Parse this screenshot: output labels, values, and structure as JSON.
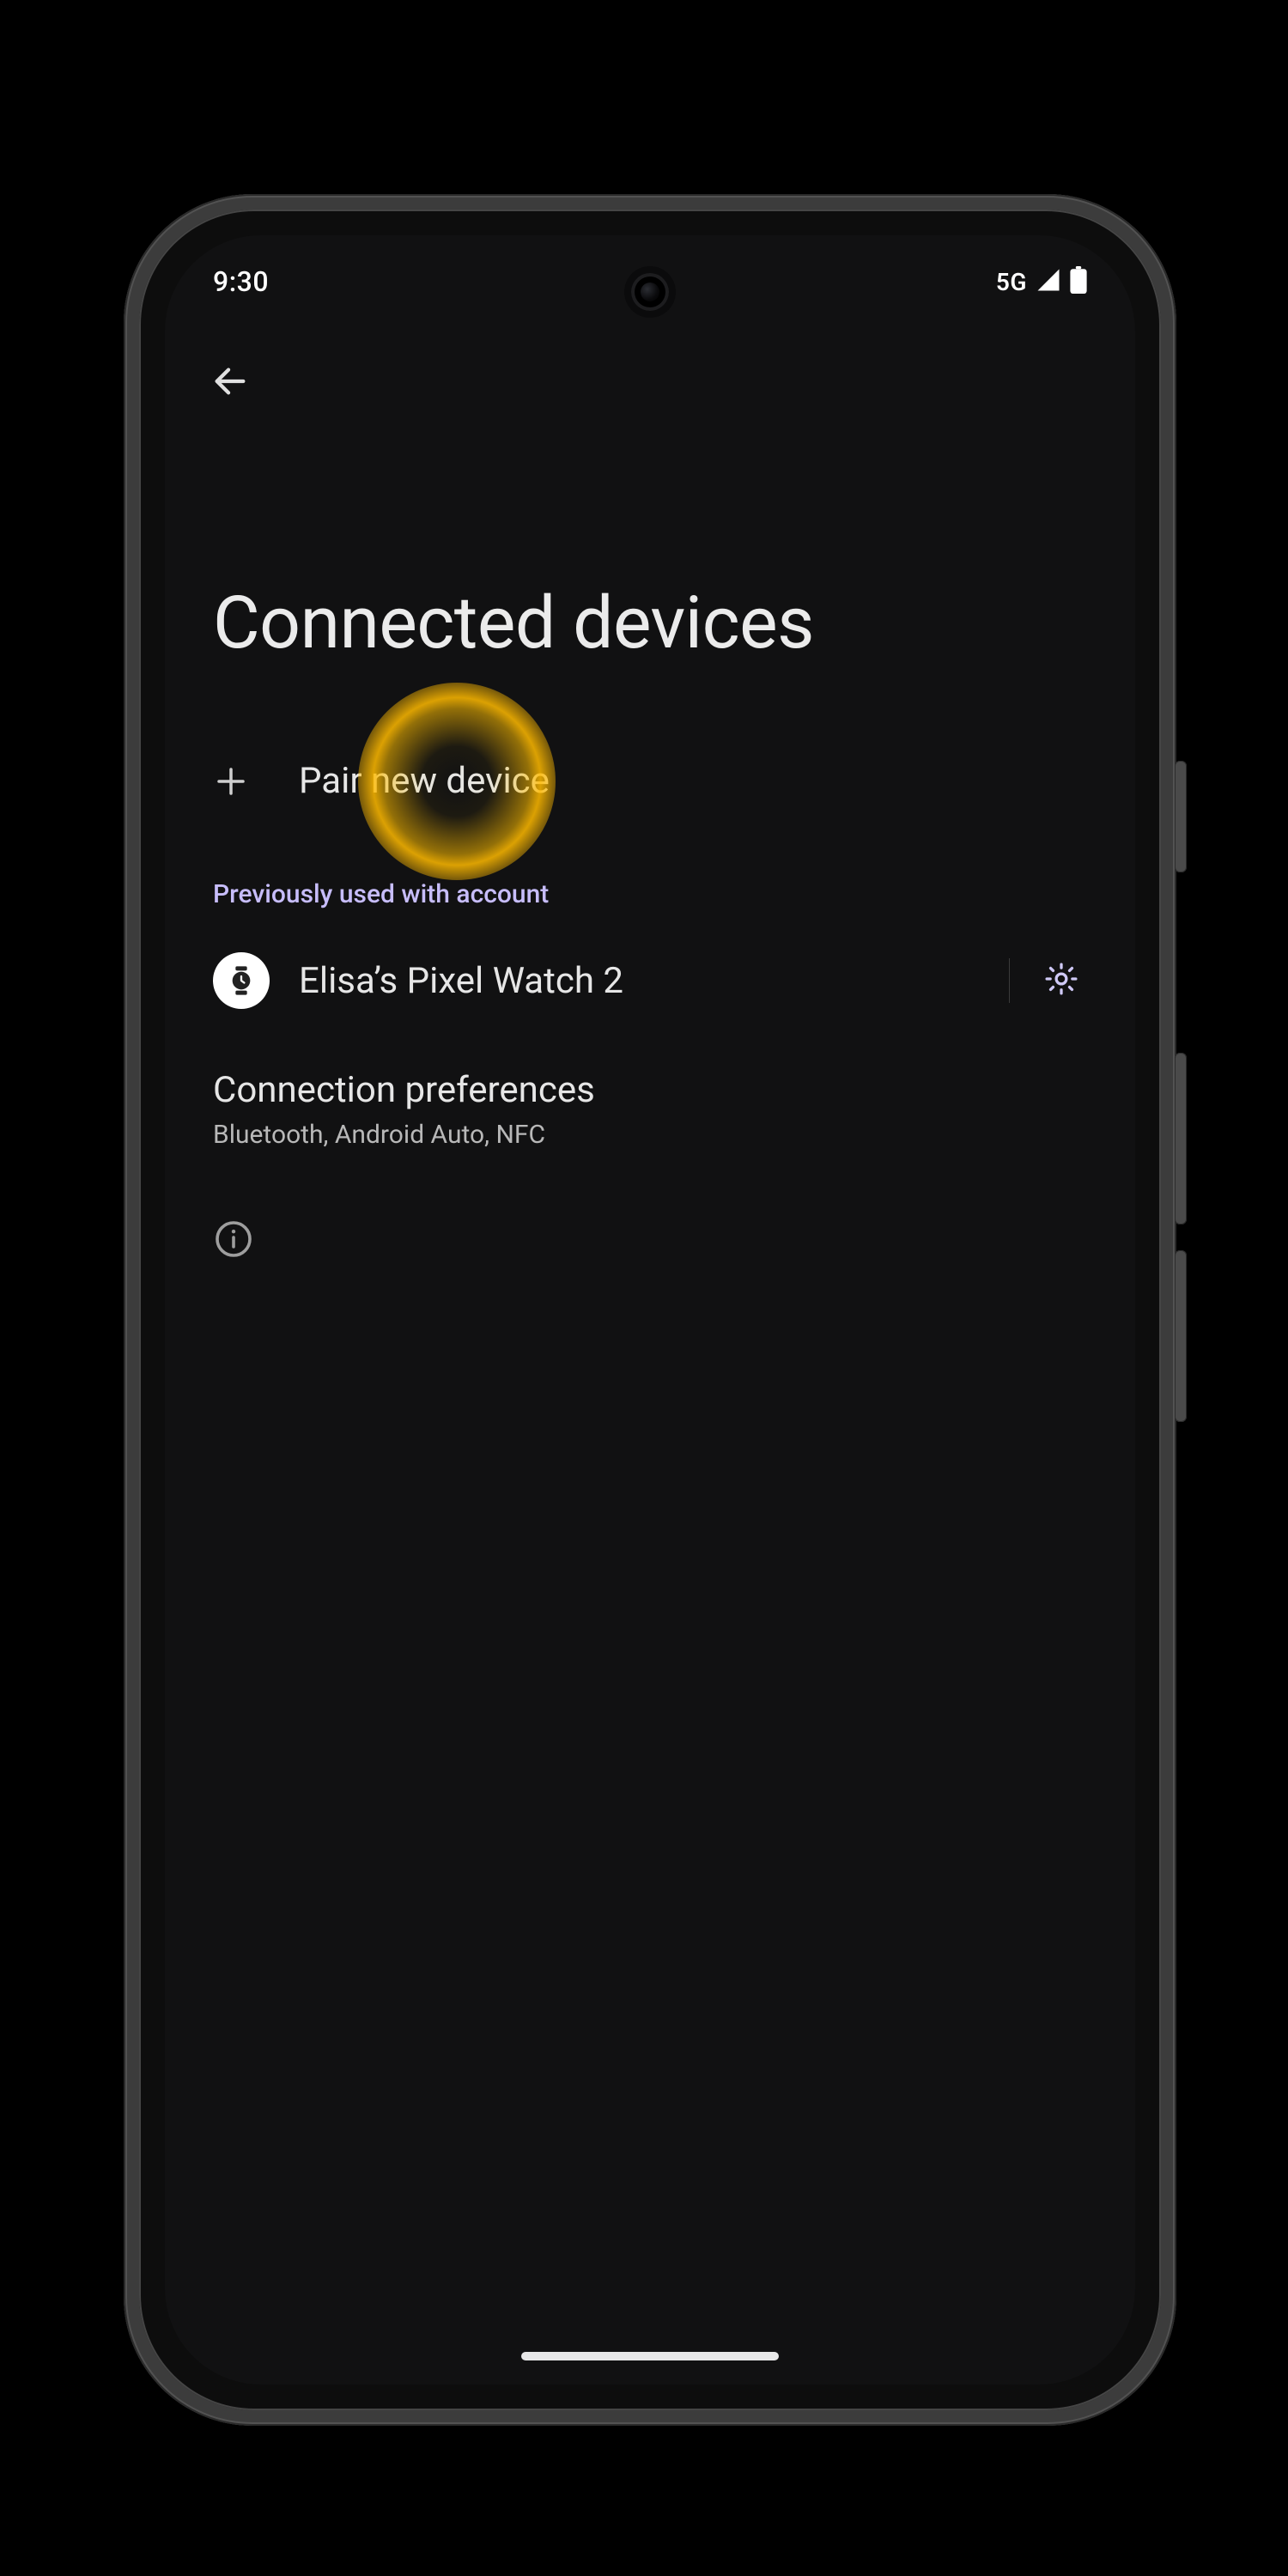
{
  "status": {
    "time": "9:30",
    "network_label": "5G"
  },
  "header": {
    "title": "Connected devices"
  },
  "pair": {
    "label": "Pair new device"
  },
  "section": {
    "prev_label": "Previously used with account"
  },
  "device": {
    "name": "Elisa’s Pixel Watch 2"
  },
  "prefs": {
    "title": "Connection preferences",
    "subtitle": "Bluetooth, Android Auto, NFC"
  },
  "icons": {
    "back": "back-arrow",
    "plus": "plus",
    "watch": "watch",
    "gear": "settings-gear",
    "info": "info-outline",
    "signal": "cell-signal-full",
    "battery": "battery-full"
  },
  "colors": {
    "accent_section_label": "#c7bdfb",
    "highlight_orb": "#ffba00",
    "screen_bg": "#111112"
  }
}
